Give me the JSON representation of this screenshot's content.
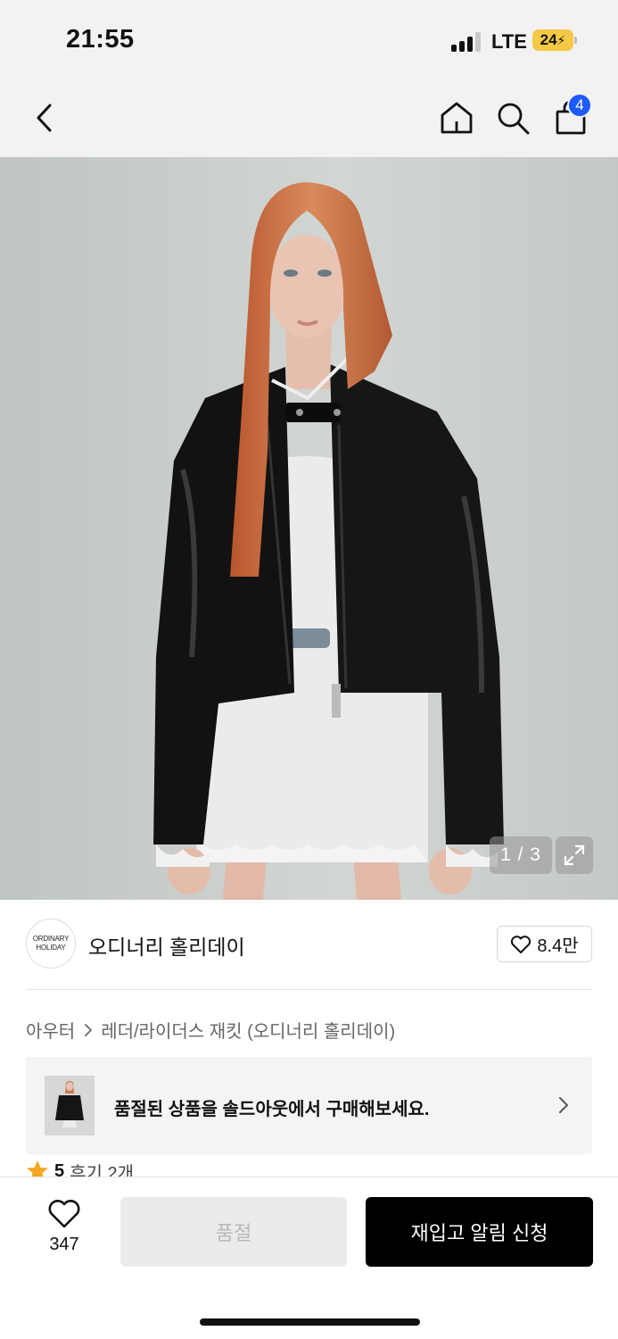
{
  "status_bar": {
    "time": "21:55",
    "network": "LTE",
    "battery": "24"
  },
  "nav": {
    "cart_count": "4"
  },
  "gallery": {
    "counter": "1 / 3"
  },
  "brand": {
    "logo_line1": "ORDINARY",
    "logo_line2": "HOLIDAY",
    "name": "오디너리 홀리데이",
    "likes": "8.4만"
  },
  "breadcrumb": {
    "category": "아우터",
    "subcategory": "레더/라이더스 재킷 (오디너리 홀리데이)"
  },
  "soldout_banner": {
    "text": "품절된 상품을 솔드아웃에서 구매해보세요."
  },
  "rating": {
    "score": "5",
    "reviews": "후기 2개"
  },
  "bottom_bar": {
    "wish_count": "347",
    "soldout_label": "품절",
    "restock_label": "재입고 알림 신청"
  },
  "colors": {
    "accent_badge": "#1e5bff",
    "star": "#f5a623",
    "primary_button": "#000000"
  }
}
